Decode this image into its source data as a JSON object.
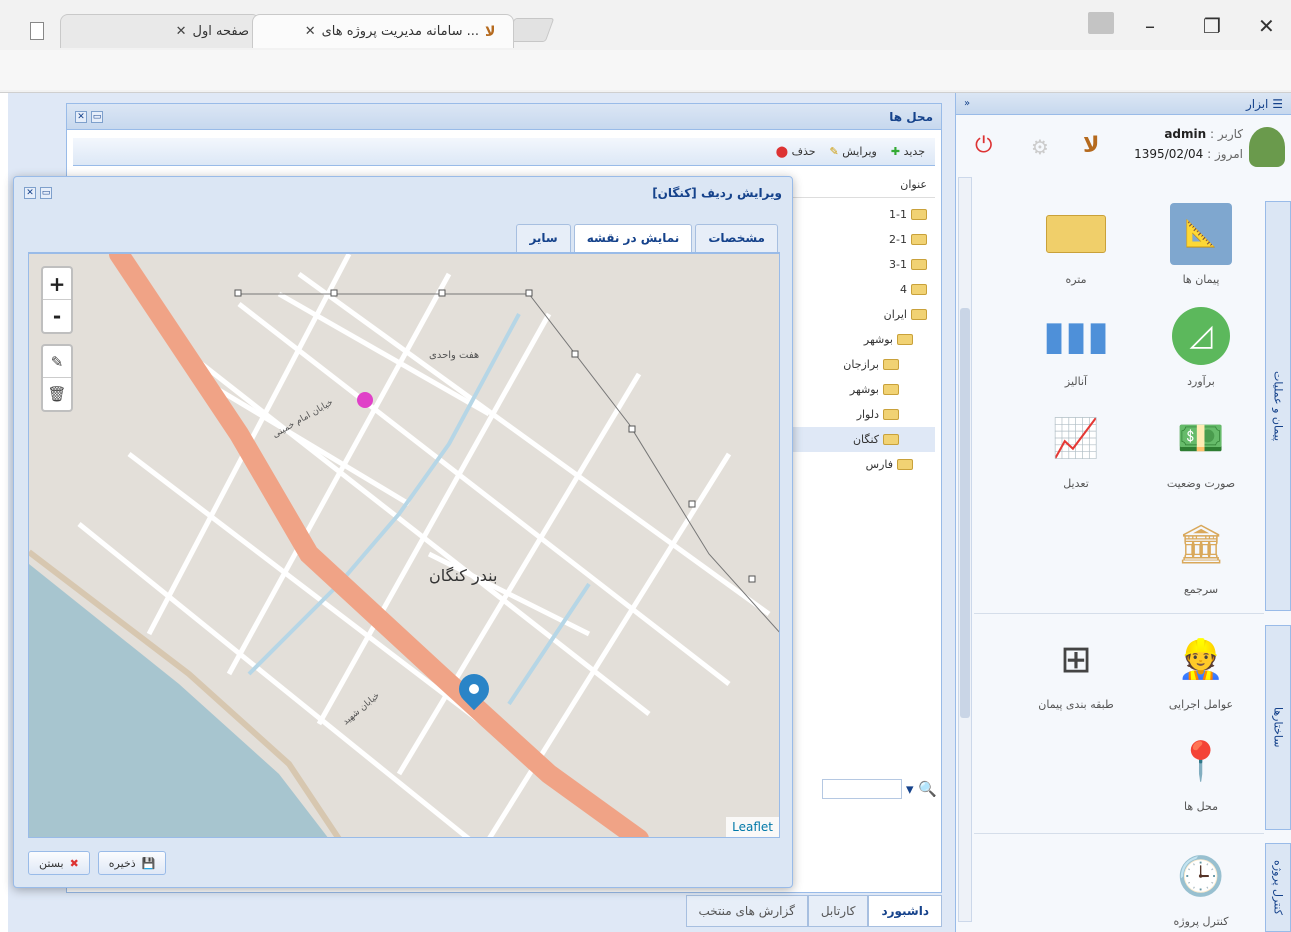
{
  "browser": {
    "tabs": [
      {
        "title": "صفحه اول",
        "active": false
      },
      {
        "title": "سامانه مدیریت پروژه های ...",
        "active": true
      }
    ],
    "address": ""
  },
  "places_panel": {
    "title": "محل ها",
    "toolbar": {
      "new": "جدید",
      "edit": "ویرایش",
      "delete": "حذف"
    },
    "column": "عنوان",
    "tree": [
      "1-1",
      "2-1",
      "3-1",
      "4",
      "ایران",
      "بوشهر",
      "برازجان",
      "بوشهر",
      "دلوار",
      "کنگان",
      "فارس"
    ]
  },
  "bottom_tabs": [
    "داشبورد",
    "کارتابل",
    "گزارش های منتخب"
  ],
  "tools_panel": {
    "title": "ابزار",
    "user_label": "کاربر :",
    "user": "admin",
    "today_label": "امروز :",
    "date": "1395/02/04",
    "apps": [
      {
        "label": "پیمان ها",
        "icon": "contract-icon"
      },
      {
        "label": "متره",
        "icon": "card-icon"
      },
      {
        "label": "برآورد",
        "icon": "estimate-icon"
      },
      {
        "label": "آنالیز",
        "icon": "bar-chart-icon"
      },
      {
        "label": "صورت وضعیت",
        "icon": "money-icon"
      },
      {
        "label": "تعدیل",
        "icon": "line-chart-icon"
      },
      {
        "label": "سرجمع",
        "icon": "building-icon"
      },
      {
        "label": "عوامل اجرایی",
        "icon": "workers-icon"
      },
      {
        "label": "طبقه بندی پیمان",
        "icon": "hierarchy-icon"
      },
      {
        "label": "محل ها",
        "icon": "location-icon"
      },
      {
        "label": "کنترل پروژه",
        "icon": "clock-icon"
      }
    ],
    "side_tabs": [
      "پیمان و عملیات",
      "ساختارها",
      "کنترل پروژه"
    ]
  },
  "dialog": {
    "title": "ویرایش ردیف [کنگان]",
    "tabs": [
      "مشخصات",
      "نمایش در نقشه",
      "سایر"
    ],
    "active_tab": "نمایش در نقشه",
    "map": {
      "zoom_in": "+",
      "zoom_out": "-",
      "city_label": "بندر کنگان",
      "street_labels": [
        "خیابان امام خمینی",
        "هفت واحدی",
        "خیابان شهید"
      ],
      "attribution": "Leaflet"
    },
    "save": "ذخیره",
    "close": "بستن"
  }
}
